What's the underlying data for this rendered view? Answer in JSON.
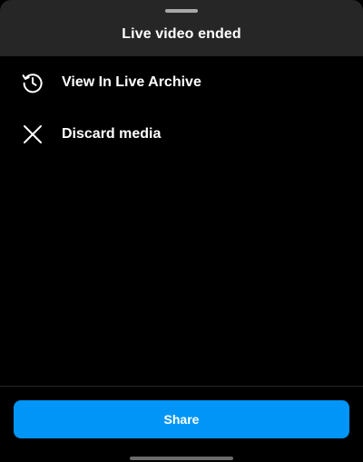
{
  "sheet": {
    "title": "Live video ended"
  },
  "menu": {
    "items": [
      {
        "label": "View In Live Archive",
        "icon": "history-icon"
      },
      {
        "label": "Discard media",
        "icon": "close-icon"
      }
    ]
  },
  "footer": {
    "share_label": "Share"
  },
  "colors": {
    "background": "#000000",
    "header": "#262626",
    "accent": "#0095f6",
    "text": "#ffffff"
  }
}
